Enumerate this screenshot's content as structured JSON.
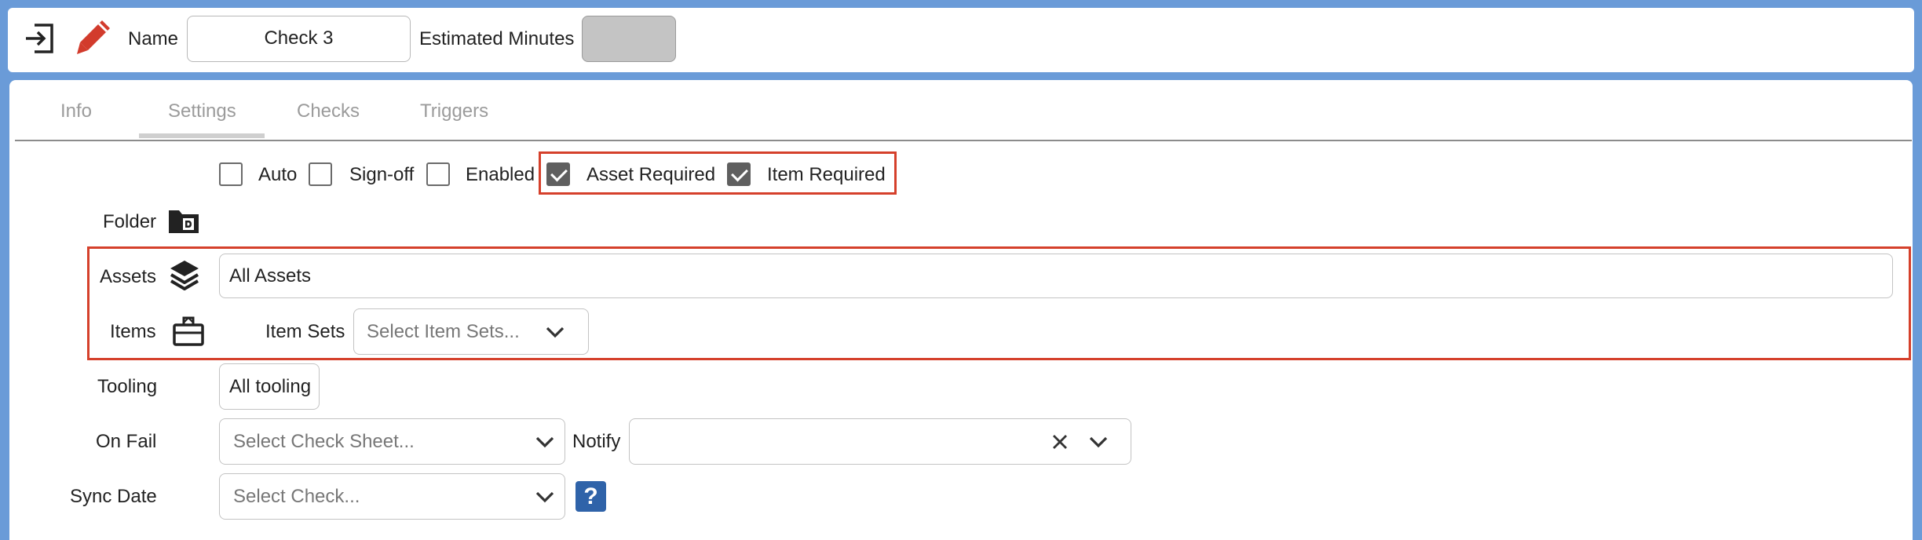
{
  "header": {
    "name_label": "Name",
    "name_value": "Check 3",
    "estimated_minutes_label": "Estimated Minutes",
    "estimated_minutes_value": ""
  },
  "tabs": [
    {
      "label": "Info",
      "active": false
    },
    {
      "label": "Settings",
      "active": true
    },
    {
      "label": "Checks",
      "active": false
    },
    {
      "label": "Triggers",
      "active": false
    }
  ],
  "checkboxes": [
    {
      "label": "Auto",
      "checked": false
    },
    {
      "label": "Sign-off",
      "checked": false
    },
    {
      "label": "Enabled",
      "checked": false
    },
    {
      "label": "Asset Required",
      "checked": true
    },
    {
      "label": "Item Required",
      "checked": true
    }
  ],
  "folder": {
    "label": "Folder",
    "icon": "folder-icon"
  },
  "assets": {
    "label": "Assets",
    "icon": "layers-icon",
    "value": "All Assets"
  },
  "items": {
    "label": "Items",
    "icon": "box-icon",
    "item_sets_label": "Item Sets",
    "item_sets_placeholder": "Select Item Sets..."
  },
  "tooling": {
    "label": "Tooling",
    "value": "All tooling"
  },
  "on_fail": {
    "label": "On Fail",
    "placeholder": "Select Check Sheet..."
  },
  "notify": {
    "label": "Notify",
    "value": ""
  },
  "sync_date": {
    "label": "Sync Date",
    "placeholder": "Select Check...",
    "help": "?"
  },
  "colors": {
    "background": "#6a9bd8",
    "highlight": "#d5402b",
    "edit_icon": "#d23b2c",
    "help_button": "#2f63a9",
    "checkbox_checked": "#5f5f5f"
  }
}
